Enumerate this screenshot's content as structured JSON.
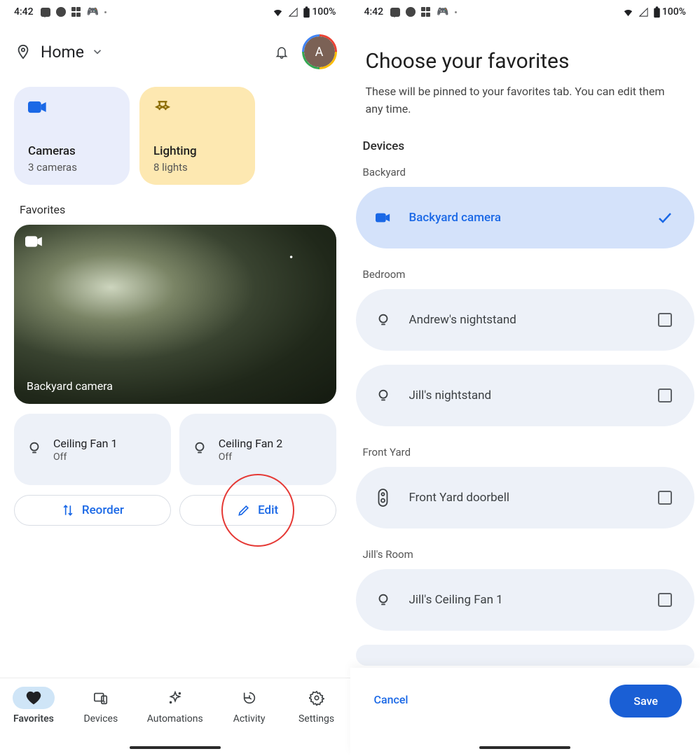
{
  "status": {
    "time": "4:42",
    "battery": "100%"
  },
  "left": {
    "header": {
      "title": "Home",
      "avatar_initial": "A"
    },
    "categories": {
      "cameras": {
        "title": "Cameras",
        "sub": "3 cameras"
      },
      "lighting": {
        "title": "Lighting",
        "sub": "8 lights"
      }
    },
    "favorites_label": "Favorites",
    "camera_card": {
      "name": "Backyard camera"
    },
    "devices": [
      {
        "title": "Ceiling Fan 1",
        "sub": "Off"
      },
      {
        "title": "Ceiling Fan 2",
        "sub": "Off"
      }
    ],
    "buttons": {
      "reorder": "Reorder",
      "edit": "Edit"
    },
    "nav": {
      "favorites": "Favorites",
      "devices": "Devices",
      "automations": "Automations",
      "activity": "Activity",
      "settings": "Settings"
    }
  },
  "right": {
    "title": "Choose your favorites",
    "subtitle": "These will be pinned to your favorites tab. You can edit them any time.",
    "section_label": "Devices",
    "groups": [
      {
        "name": "Backyard",
        "items": [
          {
            "name": "Backyard camera",
            "icon": "camera",
            "selected": true
          }
        ]
      },
      {
        "name": "Bedroom",
        "items": [
          {
            "name": "Andrew's nightstand",
            "icon": "light",
            "selected": false
          },
          {
            "name": "Jill's nightstand",
            "icon": "light",
            "selected": false
          }
        ]
      },
      {
        "name": "Front Yard",
        "items": [
          {
            "name": "Front Yard doorbell",
            "icon": "doorbell",
            "selected": false
          }
        ]
      },
      {
        "name": "Jill's Room",
        "items": [
          {
            "name": "Jill's Ceiling Fan 1",
            "icon": "light",
            "selected": false
          }
        ]
      }
    ],
    "footer": {
      "cancel": "Cancel",
      "save": "Save"
    }
  }
}
